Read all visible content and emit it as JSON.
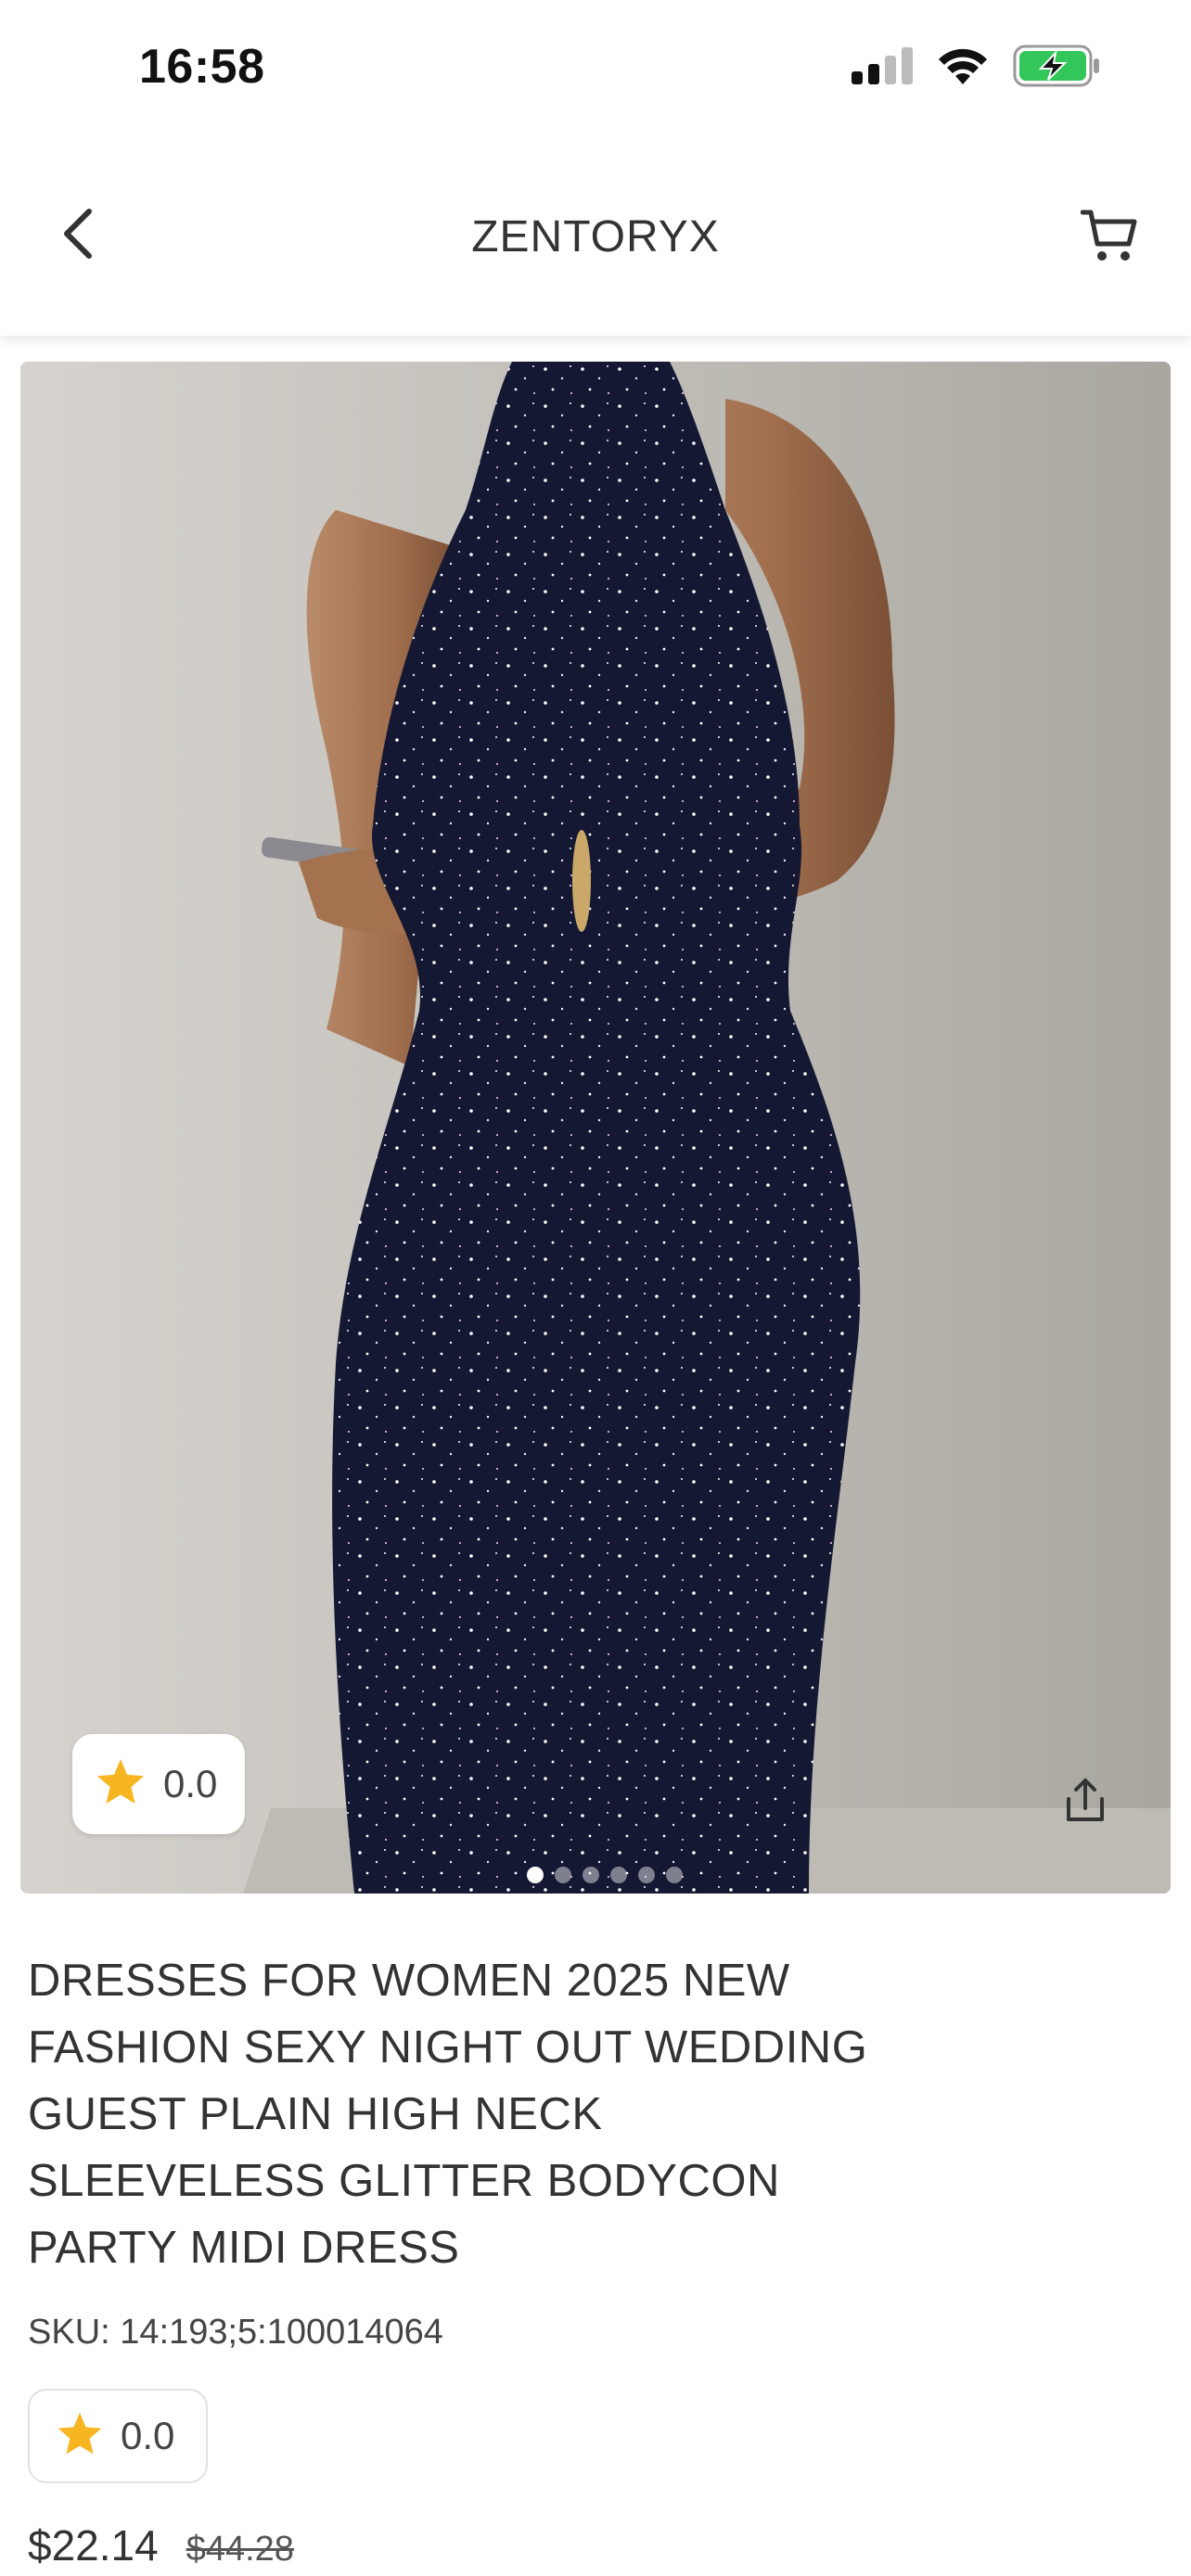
{
  "status_bar": {
    "time": "16:58"
  },
  "header": {
    "brand": "ZENTORYX"
  },
  "gallery": {
    "image_description_icon": "product-photo",
    "rating": "0.0",
    "slide_count": 6,
    "active_slide": 0
  },
  "product": {
    "title": "DRESSES FOR WOMEN 2025 NEW FASHION SEXY NIGHT OUT WEDDING GUEST PLAIN HIGH NECK SLEEVELESS GLITTER BODYCON PARTY MIDI DRESS",
    "sku": "SKU: 14:193;5:100014064",
    "rating": "0.0",
    "price": "$22.14",
    "original_price": "$44.28"
  },
  "colors": {
    "star": "#f7b521",
    "battery_green": "#33c759",
    "dress": "#14172a"
  }
}
